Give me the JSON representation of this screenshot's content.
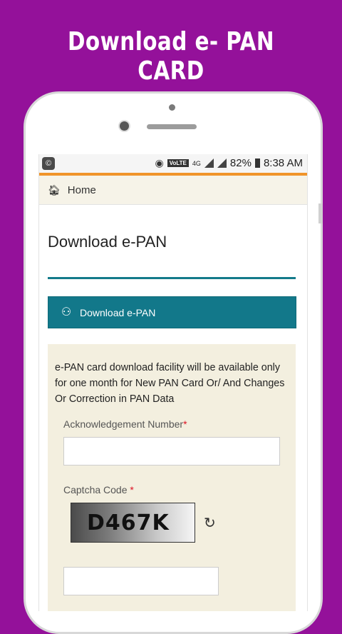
{
  "banner": {
    "title": "Download e- PAN CARD"
  },
  "status_bar": {
    "app_icon": "©",
    "volte": "VoLTE",
    "network": "4G",
    "battery": "82%",
    "time": "8:38 AM"
  },
  "nav": {
    "home_label": "Home"
  },
  "page": {
    "title": "Download e-PAN"
  },
  "download_section": {
    "label": "Download e-PAN"
  },
  "notice": {
    "text": "e-PAN card download facility will be available only for one month for New PAN Card Or/ And Changes Or Correction in PAN Data"
  },
  "form": {
    "ack_label": "Acknowledgement Number",
    "required_mark": "*",
    "captcha_label": "Captcha Code ",
    "captcha_text": "D467K"
  },
  "colors": {
    "background": "#94119a",
    "accent": "#12788a",
    "status_line": "#f0942a",
    "panel": "#f3efdf"
  }
}
